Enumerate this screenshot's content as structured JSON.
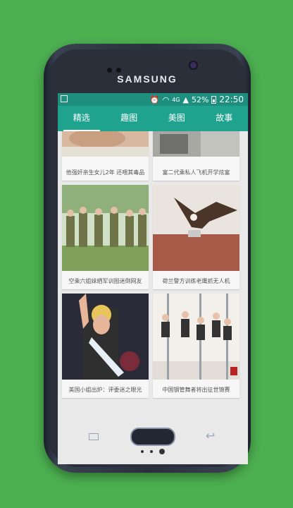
{
  "device": {
    "brand": "SAMSUNG"
  },
  "status_bar": {
    "network": "4G",
    "battery": "52%",
    "time": "22:50"
  },
  "tabs": [
    {
      "label": "精选",
      "active": true
    },
    {
      "label": "趣图",
      "active": false
    },
    {
      "label": "美图",
      "active": false
    },
    {
      "label": "故事",
      "active": false
    }
  ],
  "cards": [
    {
      "caption": "他强奸亲生女儿2年 还喂其毒品"
    },
    {
      "caption": "富二代乘私人飞机开学炫富"
    },
    {
      "caption": "空乘六姐妹晒军训图迷倒网友"
    },
    {
      "caption": "荷兰警方训练老鹰抓无人机"
    },
    {
      "caption": "美国小姐出炉：评委迷之眼光"
    },
    {
      "caption": "中国钢管舞者将出征世锦赛"
    }
  ],
  "pager": {
    "current": 3,
    "total": 3
  },
  "theme": {
    "accent": "#1fa38f",
    "statusbar": "#1e8f7f",
    "background": "#4caf50"
  }
}
